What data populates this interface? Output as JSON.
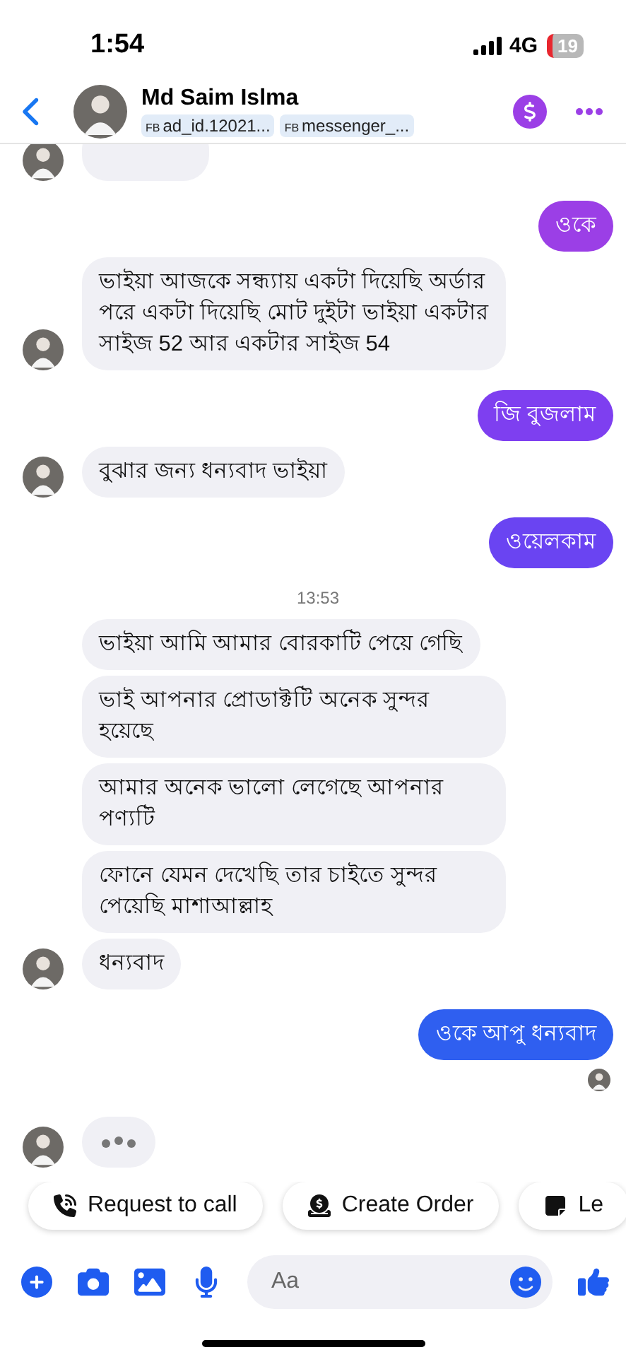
{
  "status_bar": {
    "time": "1:54",
    "network": "4G",
    "battery": "19"
  },
  "header": {
    "name": "Md Saim Islma",
    "tags": [
      {
        "prefix": "FB",
        "label": "ad_id.12021..."
      },
      {
        "prefix": "FB",
        "label": "messenger_..."
      }
    ]
  },
  "messages": [
    {
      "kind": "cut",
      "avatar": true
    },
    {
      "kind": "outgoing",
      "text": "ওকে",
      "color": "#9b3fe6",
      "seen": false
    },
    {
      "kind": "incoming",
      "text": "ভাইয়া আজকে সন্ধ্যায় একটা দিয়েছি অর্ডার পরে একটা দিয়েছি মোট দুইটা ভাইয়া একটার সাইজ 52 আর একটার সাইজ 54",
      "avatar": true
    },
    {
      "kind": "outgoing",
      "text": "জি বুজলাম",
      "color": "#7e3ff0",
      "seen": false
    },
    {
      "kind": "incoming",
      "text": "বুঝার জন্য ধন্যবাদ ভাইয়া",
      "avatar": true
    },
    {
      "kind": "outgoing",
      "text": "ওয়েলকাম",
      "color": "#6a44f2",
      "seen": false
    },
    {
      "kind": "time",
      "text": "13:53"
    },
    {
      "kind": "incoming",
      "text": "ভাইয়া আমি আমার বোরকাটি পেয়ে গেছি",
      "avatar": false
    },
    {
      "kind": "incoming",
      "text": "ভাই আপনার প্রোডাক্টটি অনেক সুন্দর হয়েছে",
      "avatar": false
    },
    {
      "kind": "incoming",
      "text": "আমার অনেক ভালো লেগেছে আপনার পণ্যটি",
      "avatar": false
    },
    {
      "kind": "incoming",
      "text": "ফোনে যেমন দেখেছি তার চাইতে সুন্দর পেয়েছি মাশাআল্লাহ",
      "avatar": false
    },
    {
      "kind": "incoming",
      "text": "ধন্যবাদ",
      "avatar": true
    },
    {
      "kind": "outgoing",
      "text": "ওকে আপু ধন্যবাদ",
      "color": "#2f5ff0",
      "seen": true
    },
    {
      "kind": "typing",
      "avatar": true
    }
  ],
  "quick_replies": [
    {
      "label": "Request to call"
    },
    {
      "label": "Create Order"
    },
    {
      "label": "Le"
    }
  ],
  "composer": {
    "placeholder": "Aa"
  }
}
